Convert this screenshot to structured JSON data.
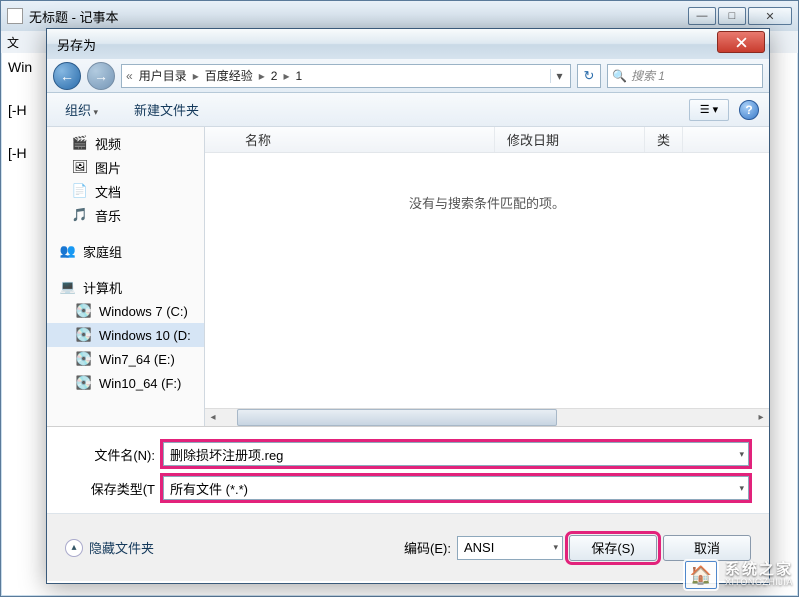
{
  "notepad": {
    "title": "无标题 - 记事本",
    "menu_file": "文",
    "body_line1": "Win",
    "body_line2": "[-H",
    "body_line3": "[-H"
  },
  "dialog": {
    "title": "另存为",
    "breadcrumb": {
      "seg1": "用户目录",
      "seg2": "百度经验",
      "seg3": "2",
      "seg4": "1"
    },
    "search_placeholder": "搜索 1",
    "toolbar": {
      "organize": "组织",
      "newfolder": "新建文件夹"
    },
    "sidebar": {
      "video": "视频",
      "pictures": "图片",
      "documents": "文档",
      "music": "音乐",
      "homegroup": "家庭组",
      "computer": "计算机",
      "drive_c": "Windows 7 (C:)",
      "drive_d": "Windows 10 (D:",
      "drive_e": "Win7_64 (E:)",
      "drive_f": "Win10_64 (F:)"
    },
    "columns": {
      "name": "名称",
      "date": "修改日期",
      "type": "类"
    },
    "empty_message": "没有与搜索条件匹配的项。",
    "filename_label": "文件名(N):",
    "filename_value": "删除损坏注册项.reg",
    "filetype_label": "保存类型(T",
    "filetype_value": "所有文件 (*.*)",
    "hide_folders": "隐藏文件夹",
    "encoding_label": "编码(E):",
    "encoding_value": "ANSI",
    "save_button": "保存(S)",
    "cancel_button": "取消"
  },
  "watermark": {
    "cn": "系统之家",
    "en": "XITONGZHIJIA"
  }
}
